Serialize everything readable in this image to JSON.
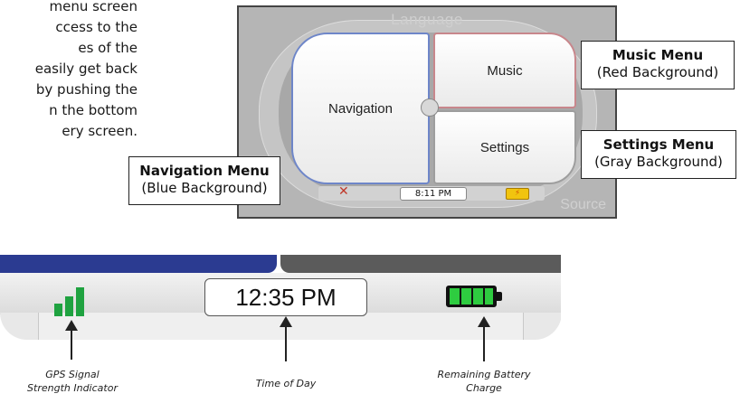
{
  "intro": {
    "lines": [
      "menu screen",
      "ccess to the",
      "es of the",
      "easily get back",
      "by pushing the",
      "n the bottom",
      "ery screen."
    ]
  },
  "device": {
    "top_label": "Language",
    "bottom_label": "Source",
    "buttons": {
      "navigation": "Navigation",
      "music": "Music",
      "settings": "Settings"
    },
    "status": {
      "time": "8:11 PM",
      "gps_icon": "gps-off-icon",
      "battery_icon": "battery-charging-icon"
    }
  },
  "callouts": {
    "music": {
      "title": "Music Menu",
      "subtitle": "(Red Background)"
    },
    "settings": {
      "title": "Settings Menu",
      "subtitle": "(Gray Background)"
    },
    "navigation": {
      "title": "Navigation Menu",
      "subtitle": "(Blue Background)"
    }
  },
  "status_bar": {
    "time": "12:35 PM",
    "colors": {
      "nav_blue": "#2b3b91",
      "gray": "#5b5b5b",
      "gps_green": "#1fa240",
      "battery_green": "#2ecc40"
    }
  },
  "captions": {
    "gps": [
      "GPS Signal",
      "Strength Indicator"
    ],
    "time": [
      "Time of Day"
    ],
    "battery": [
      "Remaining Battery",
      "Charge"
    ]
  }
}
